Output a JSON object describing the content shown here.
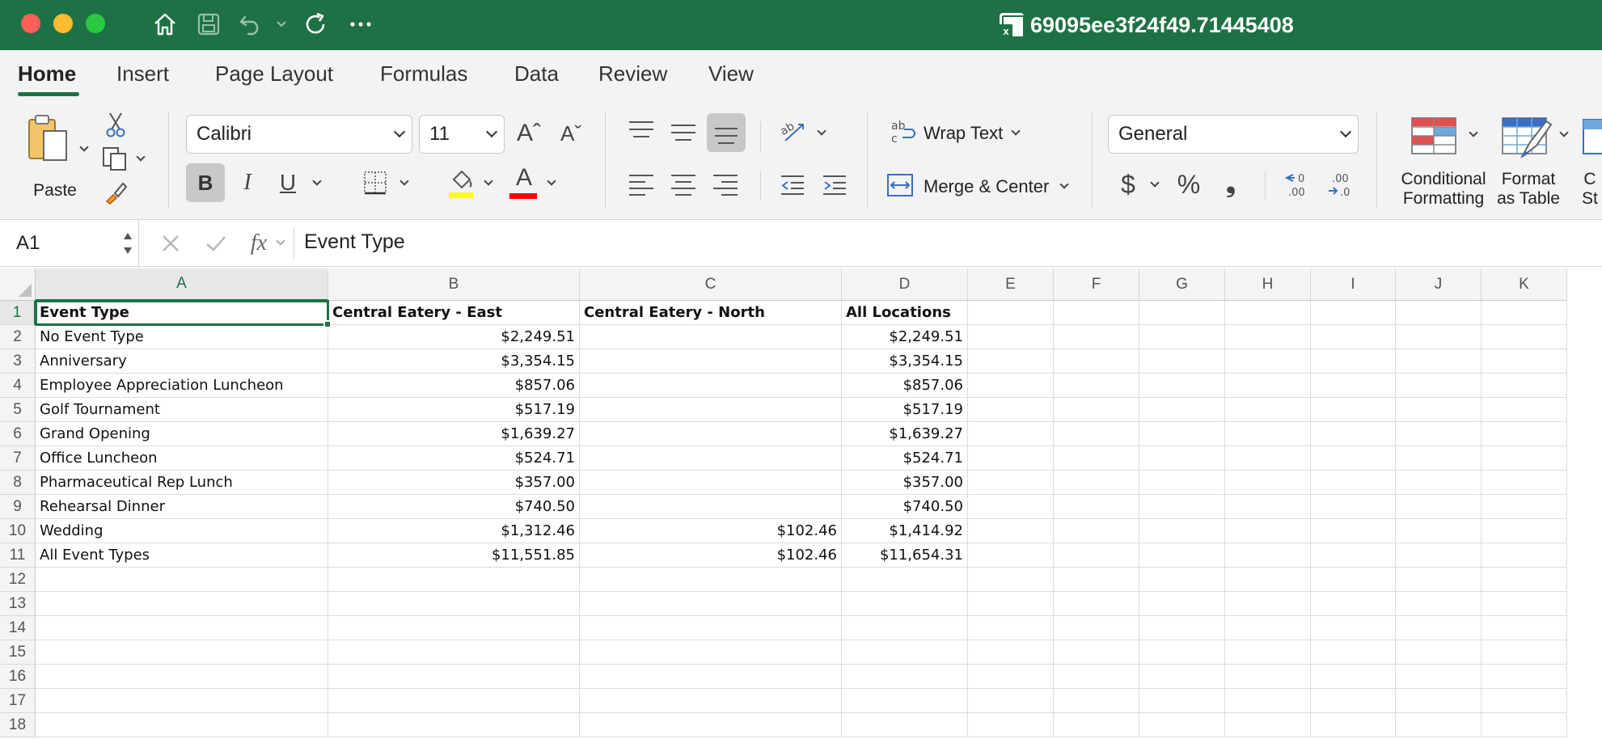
{
  "window": {
    "title": "69095ee3f24f49.71445408",
    "file_icon_letter": "x"
  },
  "tabs": [
    "Home",
    "Insert",
    "Page Layout",
    "Formulas",
    "Data",
    "Review",
    "View"
  ],
  "ribbon": {
    "paste_label": "Paste",
    "font_name": "Calibri",
    "font_size": "11",
    "wrap_text_label": "Wrap Text",
    "merge_center_label": "Merge & Center",
    "number_format": "General",
    "conditional_formatting_line1": "Conditional",
    "conditional_formatting_line2": "Formatting",
    "format_as_table_line1": "Format",
    "format_as_table_line2": "as Table",
    "cell_styles_line1": "C",
    "cell_styles_line2": "St",
    "bold_glyph": "B",
    "italic_glyph": "I",
    "underline_glyph": "U",
    "grow_font_glyph": "Aˆ",
    "shrink_font_glyph": "Aˇ",
    "font_color_glyph": "A",
    "currency_glyph": "$",
    "percent_glyph": "%",
    "comma_glyph": "❟",
    "fill_color": "#ffff00",
    "font_color": "#ff0000"
  },
  "formula_bar": {
    "name_box": "A1",
    "fx_label": "fx",
    "content": "Event Type"
  },
  "sheet": {
    "columns": [
      "A",
      "B",
      "C",
      "D",
      "E",
      "F",
      "G",
      "H",
      "I",
      "J",
      "K"
    ],
    "rows": [
      "1",
      "2",
      "3",
      "4",
      "5",
      "6",
      "7",
      "8",
      "9",
      "10",
      "11",
      "12",
      "13",
      "14",
      "15",
      "16",
      "17",
      "18"
    ],
    "selected_cell": "A1",
    "data": [
      [
        "Event Type",
        "Central Eatery - East",
        "Central Eatery - North",
        "All Locations"
      ],
      [
        "No Event Type",
        "$2,249.51",
        "",
        "$2,249.51"
      ],
      [
        "Anniversary",
        "$3,354.15",
        "",
        "$3,354.15"
      ],
      [
        "Employee Appreciation Luncheon",
        "$857.06",
        "",
        "$857.06"
      ],
      [
        "Golf Tournament",
        "$517.19",
        "",
        "$517.19"
      ],
      [
        "Grand Opening",
        "$1,639.27",
        "",
        "$1,639.27"
      ],
      [
        "Office Luncheon",
        "$524.71",
        "",
        "$524.71"
      ],
      [
        "Pharmaceutical Rep Lunch",
        "$357.00",
        "",
        "$357.00"
      ],
      [
        "Rehearsal Dinner",
        "$740.50",
        "",
        "$740.50"
      ],
      [
        "Wedding",
        "$1,312.46",
        "$102.46",
        "$1,414.92"
      ],
      [
        "All Event Types",
        "$11,551.85",
        "$102.46",
        "$11,654.31"
      ]
    ]
  },
  "colors": {
    "accent": "#1e7145",
    "close": "#ff5f57",
    "minimize": "#febc2e",
    "zoom": "#28c840"
  }
}
